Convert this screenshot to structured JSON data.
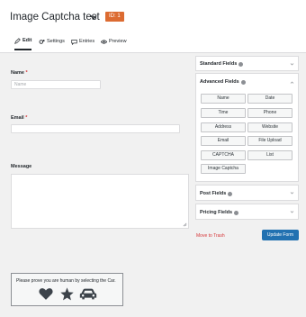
{
  "header": {
    "title": "Image Captcha test",
    "id_badge": "ID: 1"
  },
  "tabs": [
    {
      "label": "Edit",
      "icon": "pencil-icon"
    },
    {
      "label": "Settings",
      "icon": "gears-icon"
    },
    {
      "label": "Entries",
      "icon": "comment-icon"
    },
    {
      "label": "Preview",
      "icon": "eye-icon"
    }
  ],
  "form": {
    "name_label": "Name",
    "name_placeholder": "Name",
    "email_label": "Email",
    "message_label": "Message",
    "required_mark": "*",
    "captcha_prompt": "Please prove you are human by selecting the Car."
  },
  "sidebar": {
    "standard_fields": "Standard Fields",
    "advanced_fields": "Advanced Fields",
    "advanced_buttons": [
      "Name",
      "Date",
      "Time",
      "Phone",
      "Address",
      "Website",
      "Email",
      "File Upload",
      "CAPTCHA",
      "List",
      "Image Captcha"
    ],
    "post_fields": "Post Fields",
    "pricing_fields": "Pricing Fields"
  },
  "actions": {
    "trash": "Move to Trash",
    "update": "Update Form"
  },
  "colors": {
    "accent": "#2271b1",
    "badge": "#dc6b31",
    "danger": "#d63638"
  }
}
